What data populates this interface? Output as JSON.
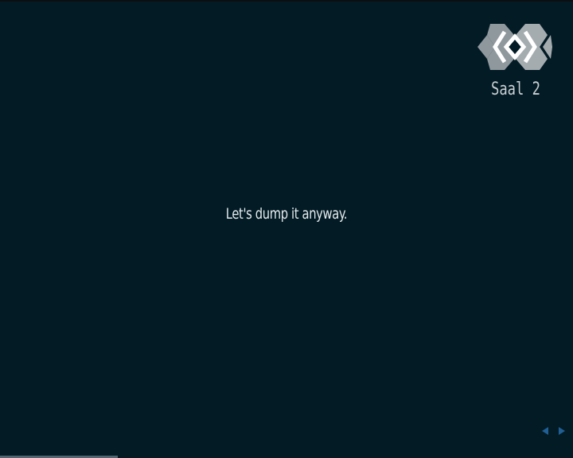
{
  "stream": {
    "subtitle": "Let's dump it anyway.",
    "room_label": "Saal 2",
    "logo_icon": "ccc-logo-icon",
    "progress_fraction": 0.205
  },
  "navigation": {
    "prev_icon": "chevron-left-icon",
    "next_icon": "chevron-right-icon"
  },
  "colors": {
    "background": "#031b25",
    "subtitle_text": "#e6ecee",
    "accent_nav": "#1f5f95",
    "logo_gray": "#9aa3a8"
  }
}
